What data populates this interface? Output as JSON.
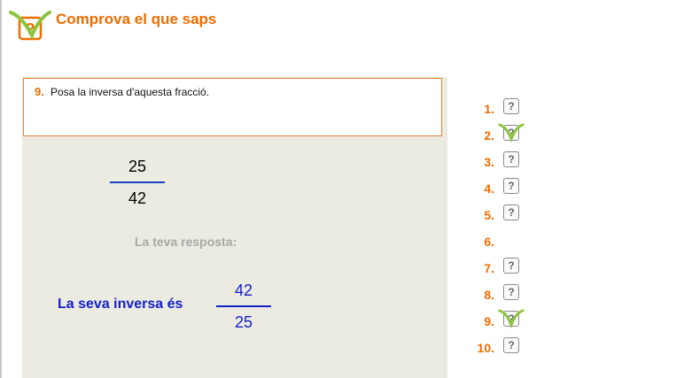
{
  "header": {
    "title": "Comprova el que saps",
    "logo_icon": "quiz-check-logo-icon"
  },
  "question": {
    "number": "9.",
    "text": "Posa la inversa d'aquesta fracció.",
    "fraction": {
      "numerator": "25",
      "denominator": "42"
    }
  },
  "response": {
    "label": "La teva resposta:",
    "inverse_label": "La seva inversa és",
    "fraction": {
      "numerator": "42",
      "denominator": "25"
    }
  },
  "question_list": [
    {
      "label": "1.",
      "state": "pending",
      "icon": "help-icon"
    },
    {
      "label": "2.",
      "state": "answered",
      "icon": "answered-check-icon"
    },
    {
      "label": "3.",
      "state": "pending",
      "icon": "help-icon"
    },
    {
      "label": "4.",
      "state": "pending",
      "icon": "help-icon"
    },
    {
      "label": "5.",
      "state": "pending",
      "icon": "help-icon"
    },
    {
      "label": "6.",
      "state": "none",
      "icon": ""
    },
    {
      "label": "7.",
      "state": "pending",
      "icon": "help-icon"
    },
    {
      "label": "8.",
      "state": "pending",
      "icon": "help-icon"
    },
    {
      "label": "9.",
      "state": "answered",
      "icon": "answered-check-icon"
    },
    {
      "label": "10.",
      "state": "pending",
      "icon": "help-icon"
    }
  ],
  "colors": {
    "accent": "#ef6c00",
    "answer_blue": "#1520c8",
    "panel_bg": "#ecebe2",
    "check_green": "#8ac53c"
  }
}
